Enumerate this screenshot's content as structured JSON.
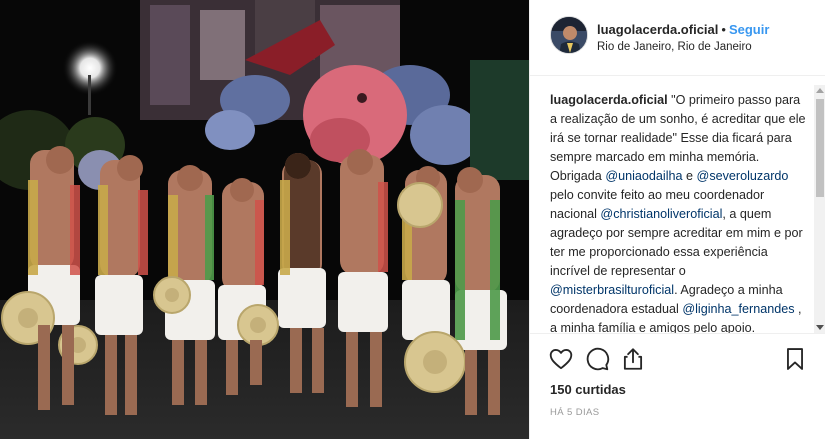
{
  "header": {
    "username": "luagolacerda.oficial",
    "separator": "•",
    "follow_label": "Seguir",
    "location": "Rio de Janeiro, Rio de Janeiro"
  },
  "caption": {
    "username": "luagolacerda.oficial",
    "text_1": " \"O primeiro passo para a realização de um sonho, é acreditar que ele irá se tornar realidade\" Esse dia ficará para sempre marcado em minha memória. Obrigada ",
    "mention_1": "@uniaodailha",
    "text_2": " e ",
    "mention_2": "@severoluzardo",
    "text_3": " pelo convite feito ao meu coordenador nacional ",
    "mention_3": "@christianoliveroficial",
    "text_4": ", a quem agradeço por sempre acreditar em mim e por ter me proporcionado essa experiência incrível de representar o ",
    "mention_4": "@misterbrasilturoficial",
    "text_5": ". Agradeço a minha coordenadora estadual ",
    "mention_5": "@liginha_fernandes",
    "text_6": " , a minha família e amigos pelo apoio."
  },
  "actions": {
    "icons": [
      "heart-icon",
      "comment-icon",
      "share-icon",
      "bookmark-icon"
    ],
    "likes": "150 curtidas",
    "time": "HÁ 5 DIAS"
  },
  "colors": {
    "follow": "#3897f0",
    "mention": "#003569",
    "text": "#262626",
    "muted": "#999999"
  }
}
